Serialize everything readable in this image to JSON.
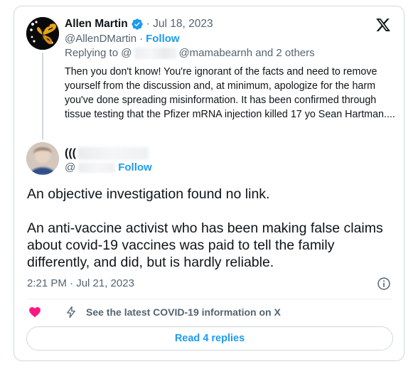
{
  "brand": {
    "logo_icon": "x-logo-icon"
  },
  "parent_tweet": {
    "display_name": "Allen Martin",
    "date": "· Jul 18, 2023",
    "handle": "@AllenDMartin",
    "separator": "·",
    "follow_label": "Follow",
    "replying_prefix": "Replying to @",
    "replying_suffix": "@mamabearnh and 2 others",
    "text": "Then you don't know! You're ignorant of the facts and need to remove yourself from the discussion and, at minimum, apologize for the harm you've done spreading misinformation. It has been confirmed through tissue testing that the Pfizer mRNA injection killed 17 yo Sean Hartman...."
  },
  "reply_tweet": {
    "display_name_prefix": "(((",
    "handle_prefix": "@",
    "follow_label": "Follow",
    "paragraphs": [
      "An objective investigation found no link.",
      "An anti-vaccine activist who has been making false claims about covid-19 vaccines was paid to tell the family differently, and did, but is hardly reliable."
    ],
    "timestamp": "2:21 PM · Jul 21, 2023"
  },
  "actions": {
    "covid_info_label": "See the latest COVID-19 information on X",
    "read_replies_label": "Read 4 replies"
  },
  "colors": {
    "accent": "#1d9bf0",
    "heart": "#f91880",
    "muted": "#536471",
    "text": "#0f1419"
  }
}
